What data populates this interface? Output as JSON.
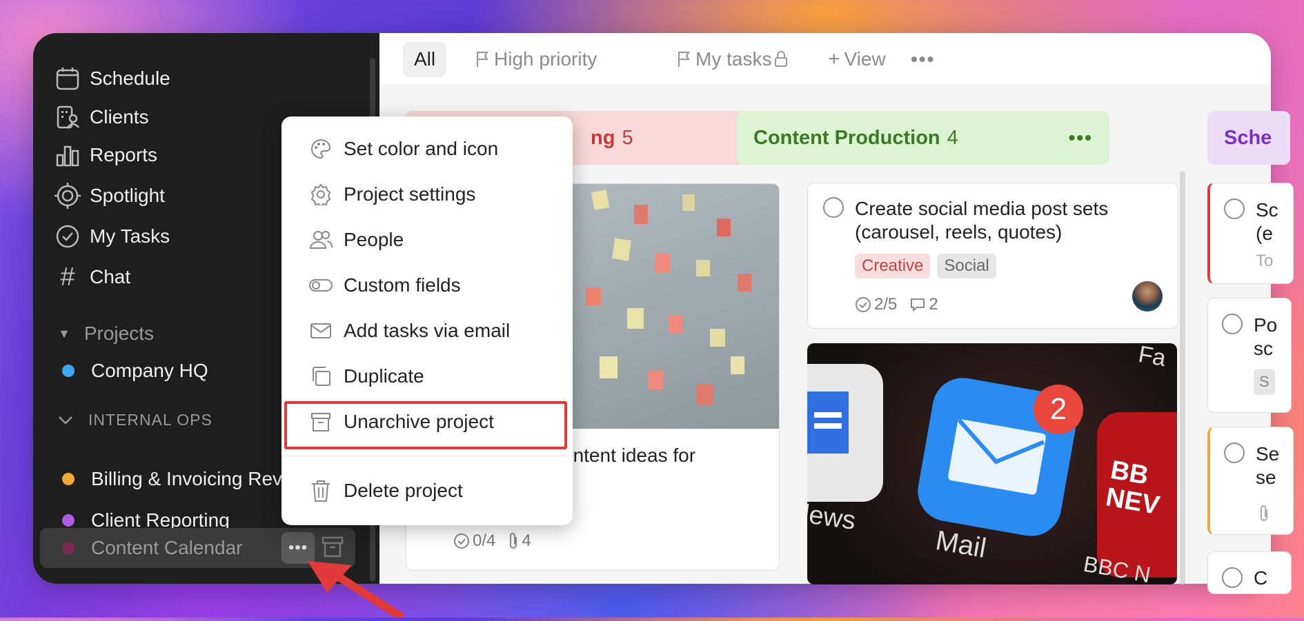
{
  "sidebar": {
    "nav": [
      {
        "label": "Schedule",
        "icon": "calendar-icon"
      },
      {
        "label": "Clients",
        "icon": "building-icon"
      },
      {
        "label": "Reports",
        "icon": "bar-chart-icon"
      },
      {
        "label": "Spotlight",
        "icon": "target-icon"
      },
      {
        "label": "My Tasks",
        "icon": "check-circle-icon"
      },
      {
        "label": "Chat",
        "icon": "hash-icon"
      }
    ],
    "projects_title": "Projects",
    "projects": [
      {
        "label": "Company HQ",
        "color": "#3ea7f0"
      }
    ],
    "group_title": "INTERNAL OPS",
    "group_projects": [
      {
        "label": "Billing & Invoicing Rev",
        "color": "#f2a93b"
      },
      {
        "label": "Client Reporting",
        "color": "#b05ee0"
      },
      {
        "label": "Content Calendar",
        "color": "#7a2a4e"
      }
    ],
    "more_label": "•••"
  },
  "topbar": {
    "tabs": [
      {
        "label": "All"
      },
      {
        "label": "High priority"
      },
      {
        "label": "My tasks"
      },
      {
        "label": "View"
      }
    ],
    "more_label": "•••"
  },
  "columns": [
    {
      "title": "ng",
      "count": "5",
      "bg": "#f9d9d9",
      "color": "#c23a3a"
    },
    {
      "title": "Content Production",
      "count": "4",
      "bg": "#dcf3d4",
      "color": "#3b7a22"
    },
    {
      "title": "Sche",
      "count": "",
      "bg": "#ecdcf6",
      "color": "#7b2fc2"
    }
  ],
  "col_dots": "•••",
  "cards": {
    "col1_card": {
      "text": "ontent ideas for",
      "checks": "0/4",
      "attachments": "4"
    },
    "col2_card": {
      "title_line1": "Create social media post sets",
      "title_line2": "(carousel, reels, quotes)",
      "tags": [
        "Creative",
        "Social"
      ],
      "checks": "2/5",
      "comments": "2"
    },
    "mail_badge": "2",
    "mail_label": "Mail",
    "news_label": "lews",
    "bbc_label_1": "BB",
    "bbc_label_2": "NEV",
    "bbc_bottom": "BBC N",
    "fa_label": "Fa",
    "col3_cards": [
      {
        "l1": "Sc",
        "l2": "(e",
        "l3": "To"
      },
      {
        "l1": "Po",
        "l2": "sc",
        "l3": "S"
      },
      {
        "l1": "Se",
        "l2": "se",
        "l3": ""
      },
      {
        "l1": "C",
        "l2": "",
        "l3": ""
      }
    ]
  },
  "menu": {
    "items": [
      {
        "label": "Set color and icon",
        "icon": "palette-icon"
      },
      {
        "label": "Project settings",
        "icon": "gear-icon"
      },
      {
        "label": "People",
        "icon": "people-icon"
      },
      {
        "label": "Custom fields",
        "icon": "toggle-icon"
      },
      {
        "label": "Add tasks via email",
        "icon": "envelope-icon"
      },
      {
        "label": "Duplicate",
        "icon": "duplicate-icon"
      },
      {
        "label": "Unarchive project",
        "icon": "archive-box-icon"
      },
      {
        "label": "Delete project",
        "icon": "trash-icon"
      }
    ]
  },
  "colors": {
    "highlight": "#e03a3a",
    "arrow": "#e03a3a"
  }
}
